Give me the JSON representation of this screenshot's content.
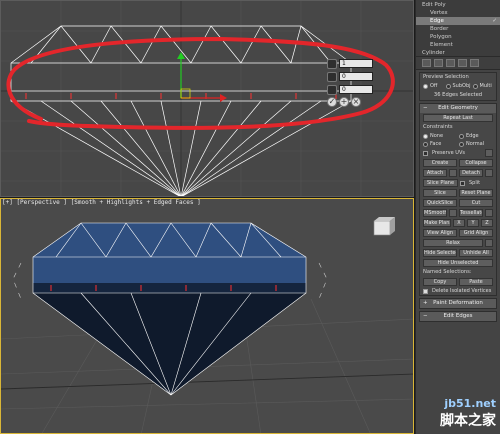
{
  "viewport_top": {
    "caddy_values": [
      "1",
      "0",
      "0"
    ]
  },
  "viewport_persp": {
    "label": "[+] [Perspective ] [Smooth + Highlights + Edged Faces ]"
  },
  "stack": {
    "items": [
      {
        "label": "Edit Poly",
        "level": 0,
        "selected": false
      },
      {
        "label": "Vertex",
        "level": 1,
        "selected": false
      },
      {
        "label": "Edge",
        "level": 1,
        "selected": true
      },
      {
        "label": "Border",
        "level": 1,
        "selected": false
      },
      {
        "label": "Polygon",
        "level": 1,
        "selected": false
      },
      {
        "label": "Element",
        "level": 1,
        "selected": false
      },
      {
        "label": "Cylinder",
        "level": 0,
        "selected": false
      }
    ]
  },
  "preview_selection": {
    "title": "Preview Selection",
    "off": "Off",
    "subobj": "SubObj",
    "multi": "Multi",
    "status": "36 Edges Selected"
  },
  "edit_geometry": {
    "title": "Edit Geometry",
    "repeat_last": "Repeat Last",
    "constraints": "Constraints",
    "none": "None",
    "edge": "Edge",
    "face": "Face",
    "normal": "Normal",
    "preserve_uvs": "Preserve UVs",
    "create": "Create",
    "collapse": "Collapse",
    "attach": "Attach",
    "detach": "Detach",
    "slice_plane": "Slice Plane",
    "split": "Split",
    "slice": "Slice",
    "reset_plane": "Reset Plane",
    "quickslice": "QuickSlice",
    "cut": "Cut",
    "msmooth": "MSmooth",
    "tessellate": "Tessellate",
    "make_planar": "Make Planar",
    "x": "X",
    "y": "Y",
    "z": "Z",
    "view_align": "View Align",
    "grid_align": "Grid Align",
    "relax": "Relax",
    "hide_selected": "Hide Selected",
    "unhide_all": "Unhide All",
    "hide_unselected": "Hide Unselected",
    "named_selections": "Named Selections:",
    "copy": "Copy",
    "paste": "Paste",
    "delete_isolated": "Delete Isolated Vertices"
  },
  "paint_deformation": {
    "title": "Paint Deformation"
  },
  "edit_edges": {
    "title": "Edit Edges"
  },
  "watermark": {
    "url": "jb51.net",
    "name": "脚本之家"
  },
  "colors": {
    "annotation_red": "#e3262b",
    "gem_blue": "#2f4f80",
    "active_border": "#d9b637"
  }
}
